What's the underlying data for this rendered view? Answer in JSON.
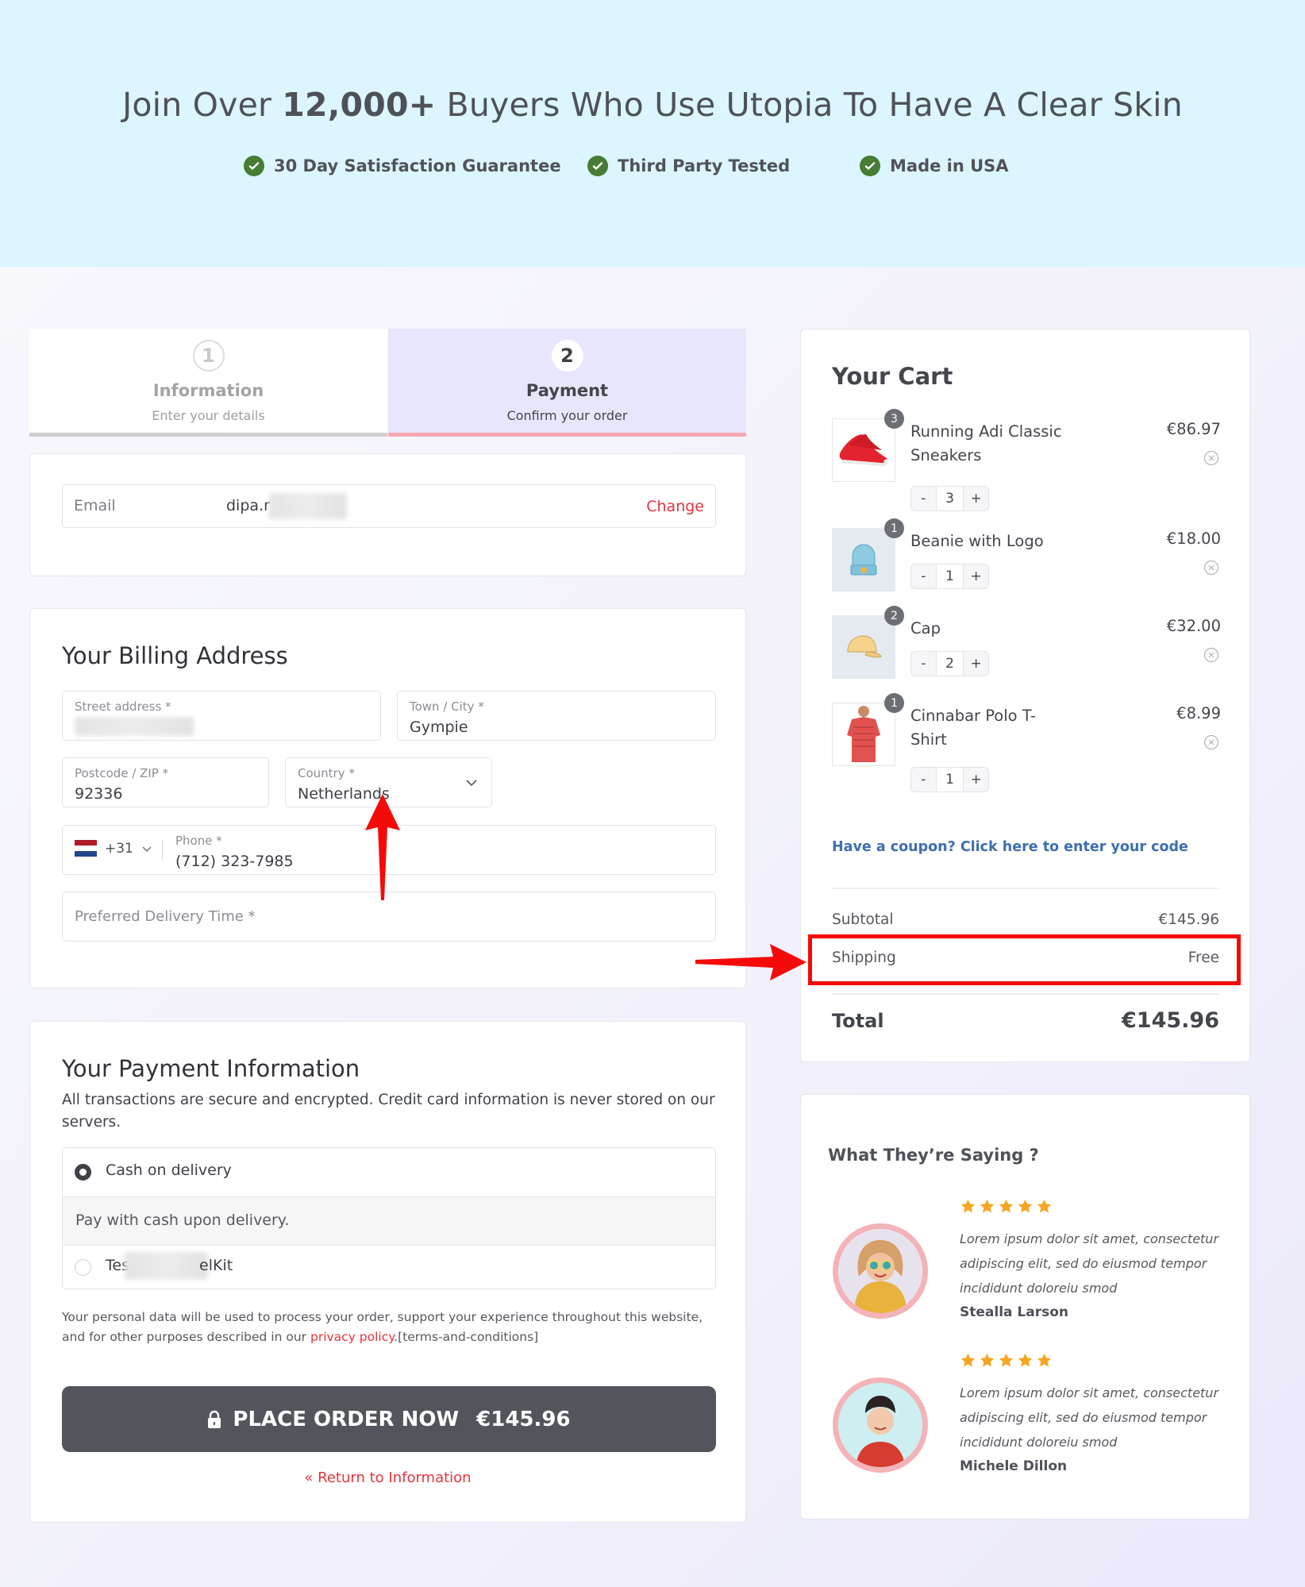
{
  "hero": {
    "title_prefix": "Join Over ",
    "title_bold": "12,000+",
    "title_suffix": " Buyers Who Use Utopia To Have A Clear Skin",
    "features": [
      {
        "icon": "check-circle-icon",
        "label": "30 Day Satisfaction Guarantee"
      },
      {
        "icon": "check-circle-icon",
        "label": "Third Party Tested"
      },
      {
        "icon": "check-circle-icon",
        "label": "Made in USA"
      }
    ]
  },
  "steps": [
    {
      "number": "1",
      "title": "Information",
      "subtitle": "Enter your details",
      "active": false
    },
    {
      "number": "2",
      "title": "Payment",
      "subtitle": "Confirm your order",
      "active": true
    }
  ],
  "email": {
    "label": "Email",
    "value_visible": "dipa.r",
    "change_label": "Change"
  },
  "billing": {
    "title": "Your Billing Address",
    "street": {
      "label": "Street address *",
      "value": ""
    },
    "city": {
      "label": "Town / City *",
      "value": "Gympie"
    },
    "postcode": {
      "label": "Postcode / ZIP *",
      "value": "92336"
    },
    "country": {
      "label": "Country *",
      "value": "Netherlands"
    },
    "phone": {
      "country_code": "+31",
      "label": "Phone *",
      "value": "(712) 323-7985"
    },
    "delivery_time": {
      "placeholder": "Preferred Delivery Time *"
    }
  },
  "payment": {
    "title": "Your Payment Information",
    "description": "All transactions are secure and encrypted. Credit card information is never stored on our servers.",
    "options": [
      {
        "label": "Cash on delivery",
        "selected": true,
        "detail": "Pay with cash upon delivery."
      },
      {
        "label_start": "Tes",
        "label_end": "elKit",
        "selected": false
      }
    ],
    "privacy_prefix": "Your personal data will be used to process your order, support your experience throughout this website, and for other purposes described in our ",
    "privacy_link": "privacy policy",
    "privacy_suffix": ".[terms-and-conditions]",
    "place_order_label": "PLACE ORDER NOW",
    "place_order_amount": "€145.96",
    "return_link": "« Return to Information"
  },
  "cart": {
    "title": "Your Cart",
    "items": [
      {
        "name": "Running Adi Classic Sneakers",
        "price": "€86.97",
        "quantity": "3"
      },
      {
        "name": "Beanie with Logo",
        "price": "€18.00",
        "quantity": "1"
      },
      {
        "name": "Cap",
        "price": "€32.00",
        "quantity": "2"
      },
      {
        "name": "Cinnabar Polo T-Shirt",
        "price": "€8.99",
        "quantity": "1"
      }
    ],
    "coupon_link": "Have a coupon? Click here to enter your code",
    "subtotal_label": "Subtotal",
    "subtotal_value": "€145.96",
    "shipping_label": "Shipping",
    "shipping_value": "Free",
    "total_label": "Total",
    "total_value": "€145.96"
  },
  "testimonials": {
    "title": "What They’re Saying ?",
    "items": [
      {
        "rating": 5,
        "quote": "Lorem ipsum dolor sit amet, consectetur adipiscing elit, sed do eiusmod tempor incididunt doloreiu smod",
        "author": "Stealla Larson"
      },
      {
        "rating": 5,
        "quote": "Lorem ipsum dolor sit amet, consectetur adipiscing elit, sed do eiusmod tempor incididunt doloreiu smod",
        "author": "Michele Dillon"
      }
    ]
  },
  "colors": {
    "hero_bg": "#dcf5fe",
    "accent_red": "#e5333d",
    "check_green": "#477c33",
    "button_dark": "#52555b",
    "link_blue": "#3d6fb2",
    "star": "#f5a623",
    "annotation_red": "#f50a0a"
  }
}
